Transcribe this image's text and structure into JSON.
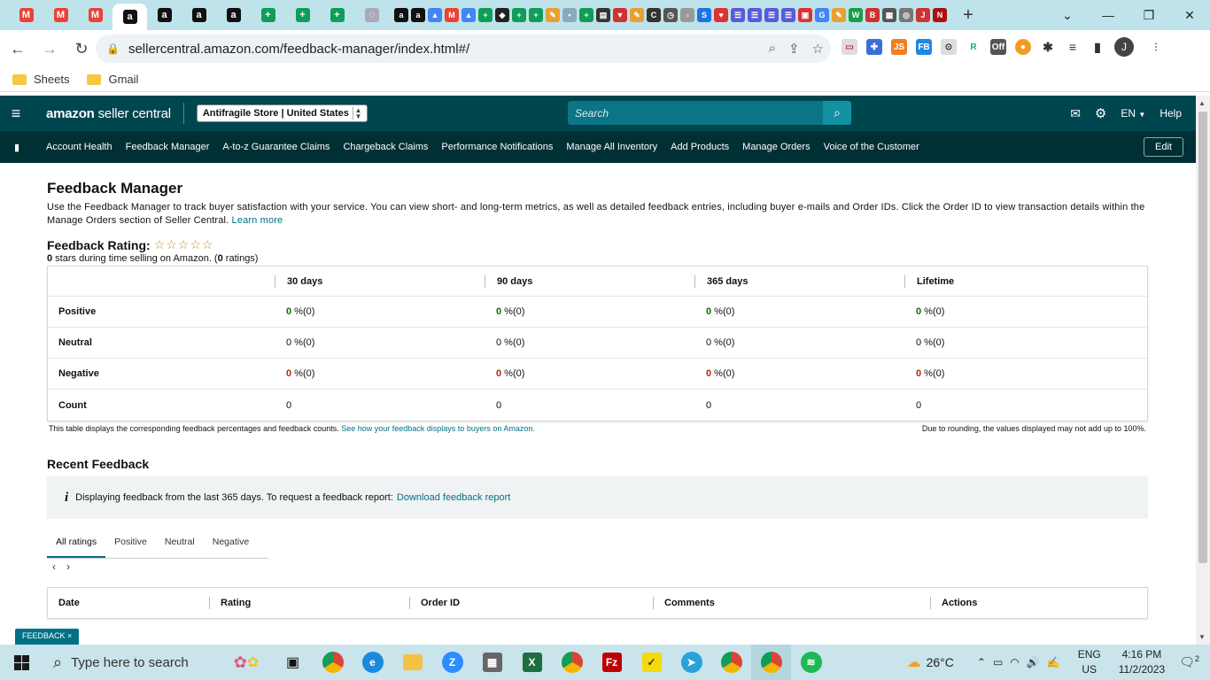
{
  "browser": {
    "url": "sellercentral.amazon.com/feedback-manager/index.html#/",
    "bookmarks": [
      "Sheets",
      "Gmail"
    ],
    "profile_initial": "J"
  },
  "header": {
    "logo_brand": "amazon",
    "logo_product": " seller central",
    "store_selector": "Antifragile Store | United States",
    "search_placeholder": "Search",
    "language": "EN",
    "help": "Help"
  },
  "nav": {
    "items": [
      "Account Health",
      "Feedback Manager",
      "A-to-z Guarantee Claims",
      "Chargeback Claims",
      "Performance Notifications",
      "Manage All Inventory",
      "Add Products",
      "Manage Orders",
      "Voice of the Customer"
    ],
    "edit": "Edit"
  },
  "page": {
    "title": "Feedback Manager",
    "description": "Use the Feedback Manager to track buyer satisfaction with your service. You can view short- and long-term metrics, as well as detailed feedback entries, including buyer e-mails and Order IDs. Click the Order ID to view transaction details within the Manage Orders section of Seller Central.",
    "learn_more": "Learn more",
    "rating_label": "Feedback Rating:",
    "rating_stars": "☆☆☆☆☆",
    "rating_sub_count": "0",
    "rating_sub_mid": " stars during time selling on Amazon. (",
    "rating_sub_ratings": "0",
    "rating_sub_end": " ratings)"
  },
  "metrics": {
    "columns": [
      "30 days",
      "90 days",
      "365 days",
      "Lifetime"
    ],
    "rows": [
      {
        "label": "Positive",
        "cells": [
          [
            "0",
            " %(0)"
          ],
          [
            "0",
            " %(0)"
          ],
          [
            "0",
            " %(0)"
          ],
          [
            "0",
            " %(0)"
          ]
        ]
      },
      {
        "label": "Neutral",
        "cells": [
          [
            "0",
            " %(0)"
          ],
          [
            "0",
            " %(0)"
          ],
          [
            "0",
            " %(0)"
          ],
          [
            "0",
            " %(0)"
          ]
        ]
      },
      {
        "label": "Negative",
        "cells": [
          [
            "0",
            " %(0)"
          ],
          [
            "0",
            " %(0)"
          ],
          [
            "0",
            " %(0)"
          ],
          [
            "0",
            " %(0)"
          ]
        ]
      },
      {
        "label": "Count",
        "cells": [
          [
            "0",
            ""
          ],
          [
            "0",
            ""
          ],
          [
            "0",
            ""
          ],
          [
            "0",
            ""
          ]
        ]
      }
    ],
    "note_left": "This table displays the corresponding feedback percentages and feedback counts.",
    "note_link": "See how your feedback displays to buyers on Amazon.",
    "note_right": "Due to rounding, the values displayed may not add up to 100%."
  },
  "recent": {
    "title": "Recent Feedback",
    "info_text": "Displaying feedback from the last 365 days. To request a feedback report:",
    "info_link": "Download feedback report",
    "tabs": [
      "All ratings",
      "Positive",
      "Neutral",
      "Negative"
    ],
    "table_columns": [
      "Date",
      "Rating",
      "Order ID",
      "Comments",
      "Actions"
    ]
  },
  "feedback_tab": "FEEDBACK ×",
  "taskbar": {
    "search_placeholder": "Type here to search",
    "weather": "26°C",
    "lang_1": "ENG",
    "lang_2": "US",
    "time": "4:16 PM",
    "date": "11/2/2023",
    "notifications": "2"
  },
  "colors": {
    "header_bg": "#00464f",
    "nav_bg": "#002f36",
    "link": "#007185",
    "positive": "#007600",
    "negative": "#b12704"
  }
}
